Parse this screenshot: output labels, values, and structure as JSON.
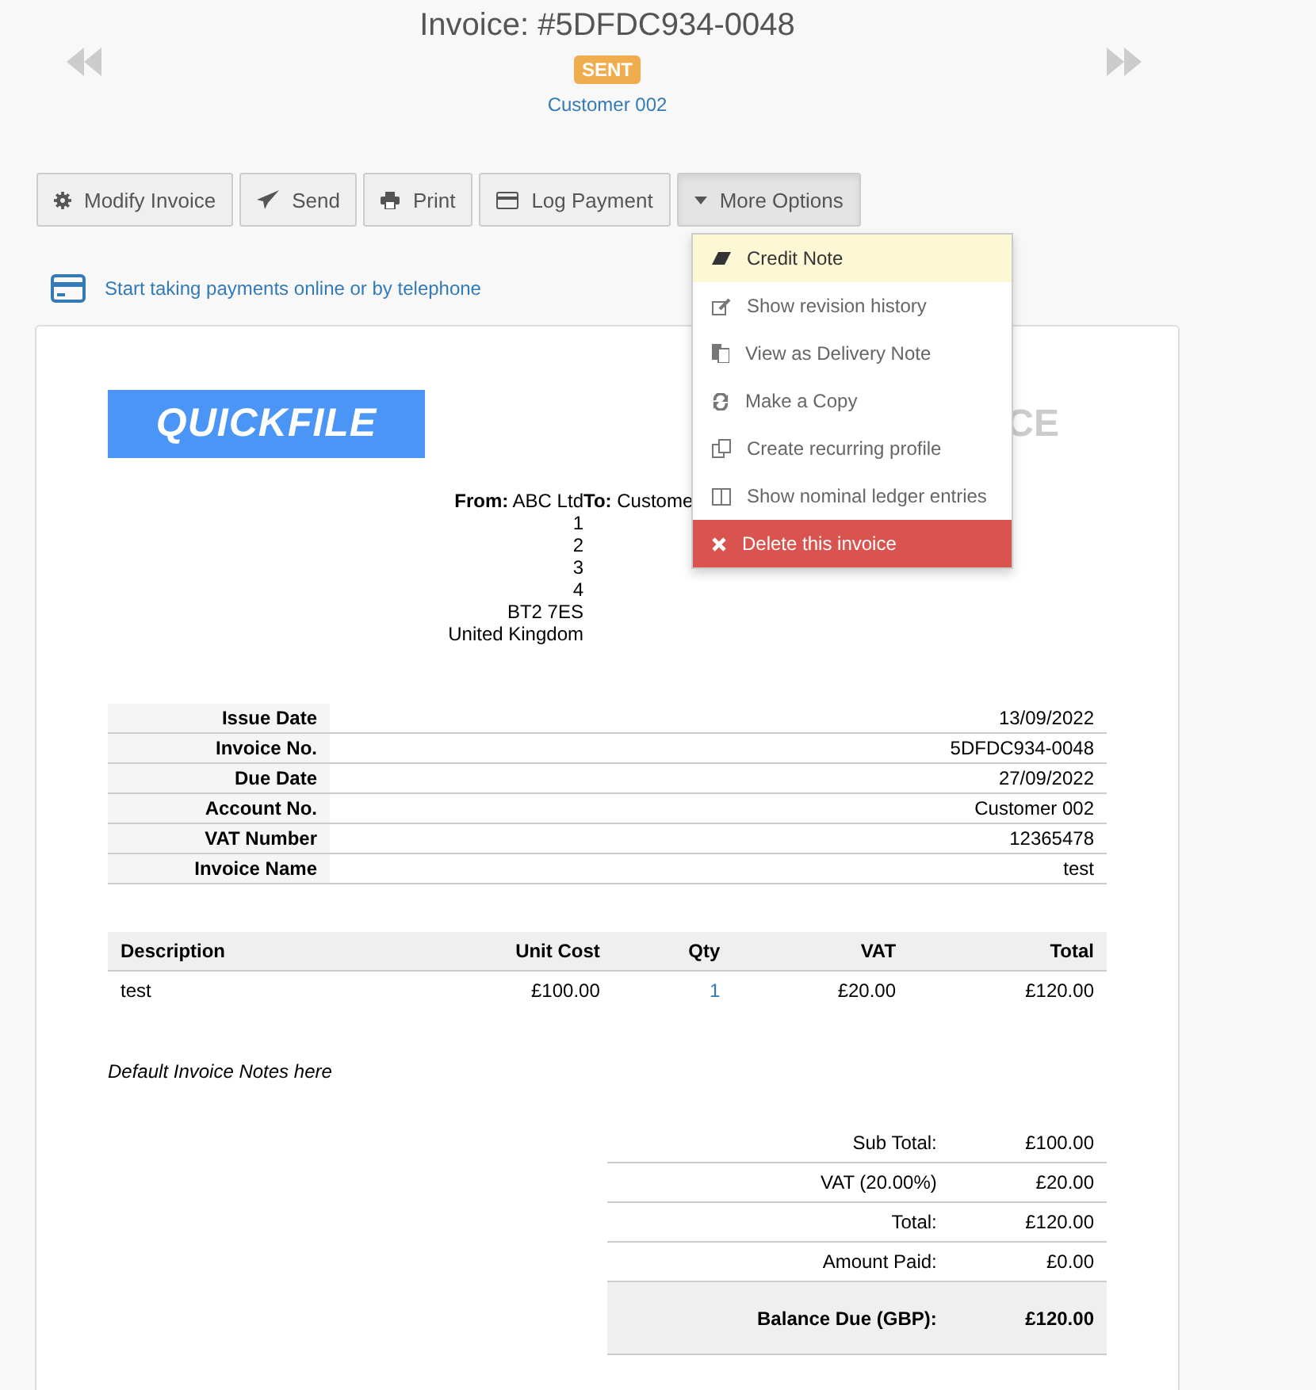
{
  "header": {
    "title": "Invoice: #5DFDC934-0048",
    "status": "SENT",
    "customer": "Customer 002"
  },
  "toolbar": [
    {
      "label": "Modify Invoice",
      "kind": "gear"
    },
    {
      "label": "Send",
      "kind": "send"
    },
    {
      "label": "Print",
      "kind": "print"
    },
    {
      "label": "Log Payment",
      "kind": "card"
    },
    {
      "label": "More Options",
      "kind": "caret",
      "expanded": true
    }
  ],
  "menu": [
    {
      "label": "Credit Note",
      "kind": "highlight"
    },
    {
      "label": "Show revision history",
      "kind": "normal"
    },
    {
      "label": "View as Delivery Note",
      "kind": "normal"
    },
    {
      "label": "Make a Copy",
      "kind": "normal"
    },
    {
      "label": "Create recurring profile",
      "kind": "normal"
    },
    {
      "label": "Show nominal ledger entries",
      "kind": "normal"
    },
    {
      "label": "Delete this invoice",
      "kind": "danger"
    }
  ],
  "payment_link": "Start taking payments online or by telephone",
  "invoice": {
    "logo": "QUICKFILE",
    "heading": "CE",
    "from": {
      "label": "From:",
      "name": "ABC Ltd",
      "lines": [
        "1",
        "2",
        "3",
        "4",
        "BT2 7ES",
        "United Kingdom"
      ]
    },
    "to": {
      "label": "To:",
      "name": "Custome"
    },
    "details": [
      {
        "label": "Issue Date",
        "value": "13/09/2022"
      },
      {
        "label": "Invoice No.",
        "value": "5DFDC934-0048"
      },
      {
        "label": "Due Date",
        "value": "27/09/2022"
      },
      {
        "label": "Account No.",
        "value": "Customer 002"
      },
      {
        "label": "VAT Number",
        "value": "12365478"
      },
      {
        "label": "Invoice Name",
        "value": "test"
      }
    ],
    "columns": [
      "Description",
      "Unit Cost",
      "Qty",
      "VAT",
      "Total"
    ],
    "rows": [
      [
        "test",
        "£100.00",
        "1",
        "£20.00",
        "£120.00"
      ]
    ],
    "notes": "Default Invoice Notes here",
    "totals": [
      {
        "label": "Sub Total:",
        "value": "£100.00",
        "kind": "normal"
      },
      {
        "label": "VAT (20.00%)",
        "value": "£20.00",
        "kind": "normal"
      },
      {
        "label": "Total:",
        "value": "£120.00",
        "kind": "normal"
      },
      {
        "label": "Amount Paid:",
        "value": "£0.00",
        "kind": "normal"
      },
      {
        "label": "Balance Due (GBP):",
        "value": "£120.00",
        "kind": "balance"
      }
    ]
  }
}
